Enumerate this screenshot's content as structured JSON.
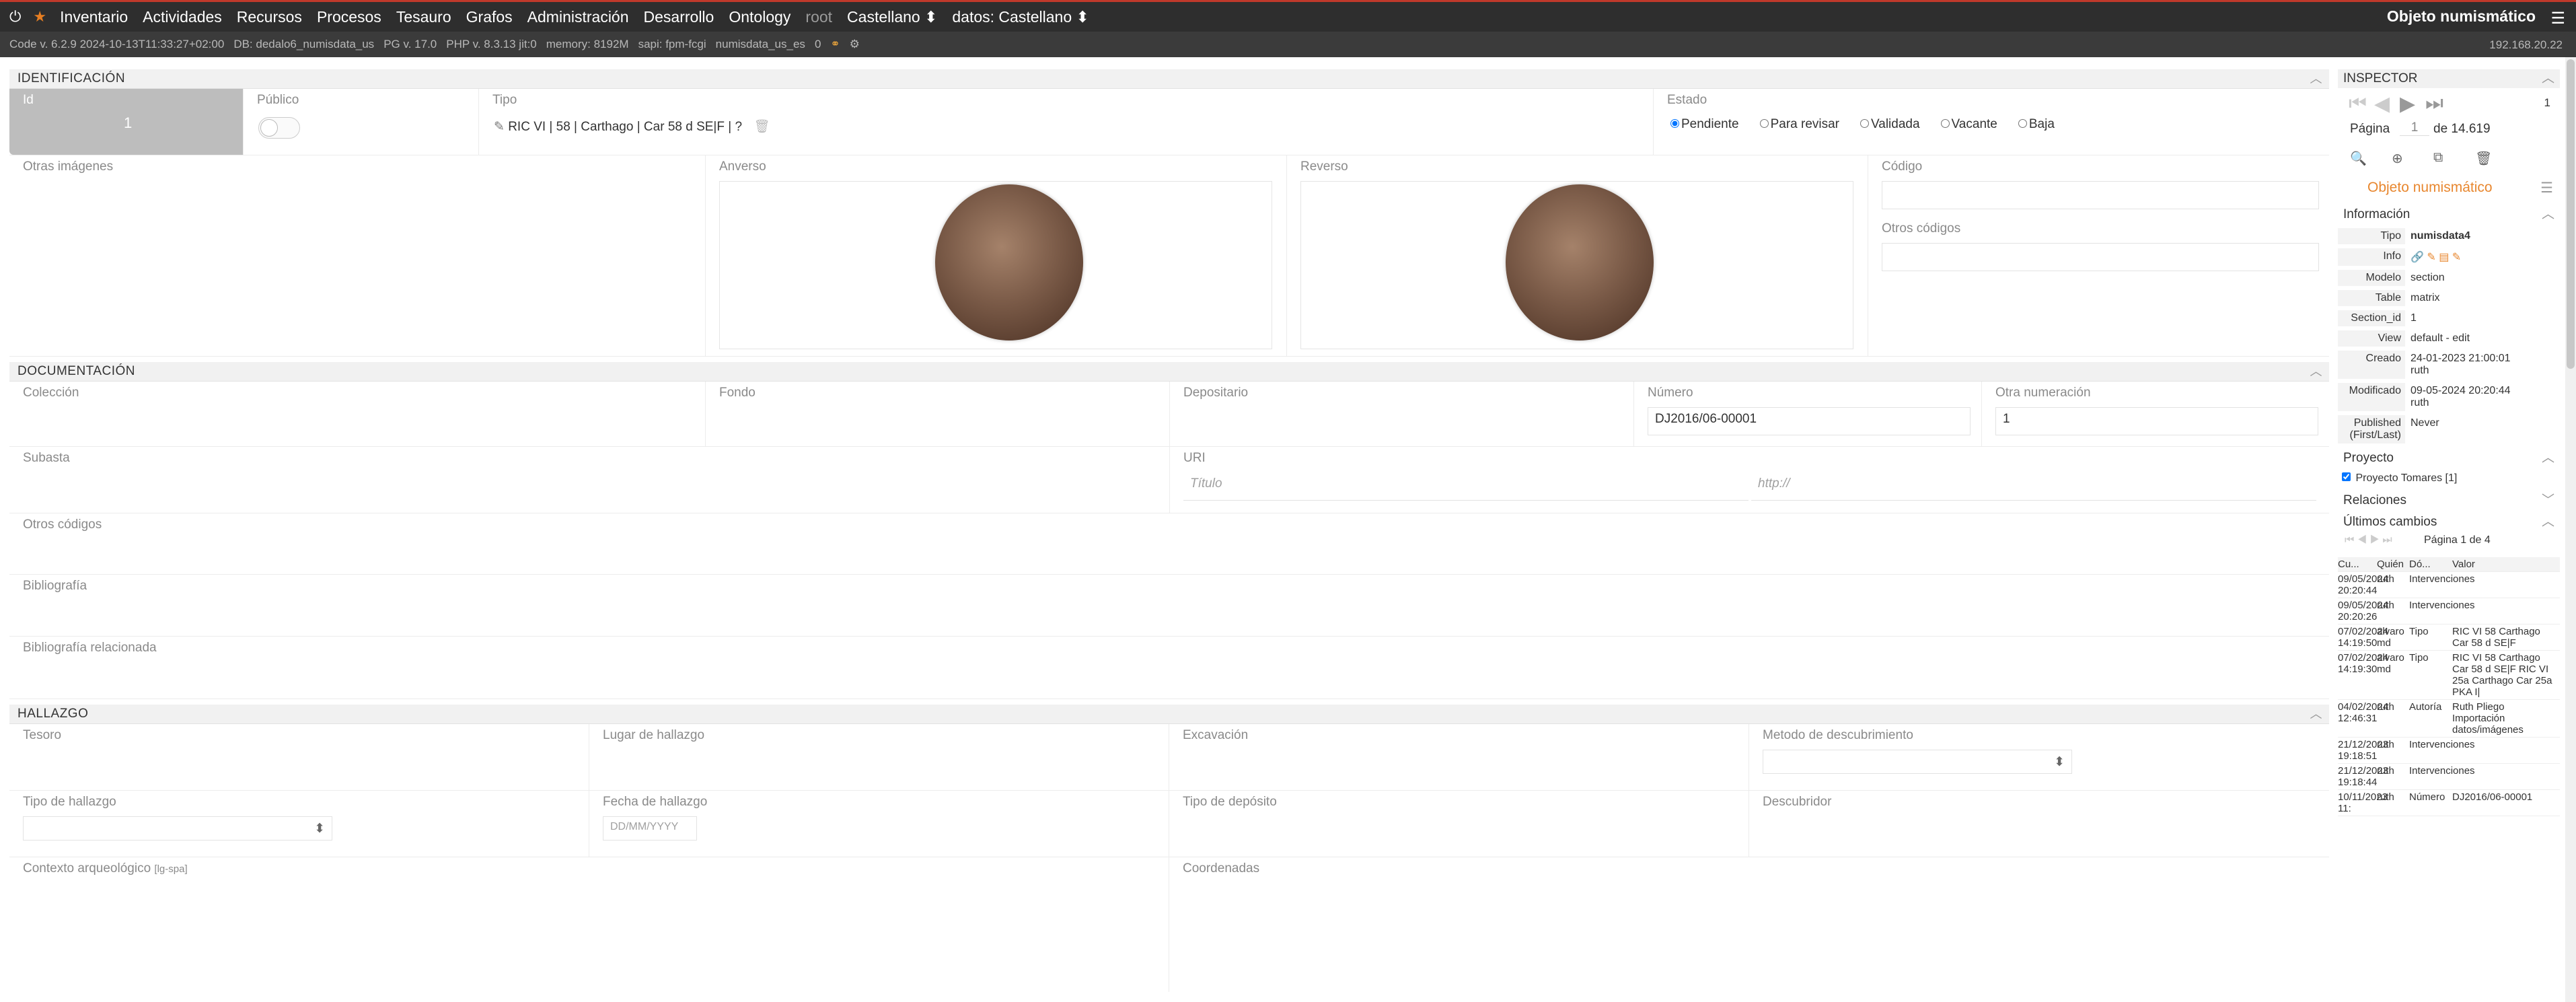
{
  "topnav": {
    "power_icon": "⏻",
    "home_icon": "★",
    "items": [
      "Inventario",
      "Actividades",
      "Recursos",
      "Procesos",
      "Tesauro",
      "Grafos",
      "Administración",
      "Desarrollo"
    ],
    "ontology": "Ontology",
    "user": "root",
    "lang": "Castellano ⬍",
    "data_lang": "datos: Castellano ⬍",
    "section_title": "Objeto numismático",
    "menu_icon": "☰"
  },
  "infobar": {
    "code": "Code v. 6.2.9 2024-10-13T11:33:27+02:00",
    "db": "DB: dedalo6_numisdata_us",
    "pg": "PG v. 17.0",
    "php": "PHP v. 8.3.13 jit:0",
    "memory": "memory: 8192M",
    "sapi": "sapi: fpm-fcgi",
    "entity": "numisdata_us_es",
    "count": "0",
    "ip": "192.168.20.22"
  },
  "identificacion": {
    "title": "IDENTIFICACIÓN",
    "id_label": "Id",
    "id_value": "1",
    "publico_label": "Público",
    "tipo_label": "Tipo",
    "tipo_value": "RIC VI | 58 | Carthago | Car 58 d SE|F | ?",
    "estado_label": "Estado",
    "estado_options": [
      "Pendiente",
      "Para revisar",
      "Validada",
      "Vacante",
      "Baja"
    ],
    "otras_imagenes": "Otras imágenes",
    "anverso": "Anverso",
    "reverso": "Reverso",
    "codigo": "Código",
    "otros_codigos": "Otros códigos"
  },
  "documentacion": {
    "title": "DOCUMENTACIÓN",
    "coleccion": "Colección",
    "fondo": "Fondo",
    "depositario": "Depositario",
    "numero": "Número",
    "numero_value": "DJ2016/06-00001",
    "otra_numeracion": "Otra numeración",
    "otra_numeracion_value": "1",
    "subasta": "Subasta",
    "uri": "URI",
    "uri_title_placeholder": "Título",
    "uri_url_placeholder": "http://",
    "otros_codigos": "Otros códigos",
    "bibliografia": "Bibliografía",
    "bibliografia_rel": "Bibliografía relacionada"
  },
  "hallazgo": {
    "title": "HALLAZGO",
    "tesoro": "Tesoro",
    "lugar": "Lugar de hallazgo",
    "excavacion": "Excavación",
    "metodo": "Metodo de descubrimiento",
    "tipo": "Tipo de hallazgo",
    "fecha": "Fecha de hallazgo",
    "fecha_placeholder": "DD/MM/YYYY",
    "deposito": "Tipo de depósito",
    "descubridor": "Descubridor",
    "contexto": "Contexto arqueológico",
    "contexto_note": "[lg-spa]",
    "coordenadas": "Coordenadas"
  },
  "inspector": {
    "title": "INSPECTOR",
    "nav_count": "1",
    "pagina_label": "Página",
    "pagina_value": "1",
    "pagina_total": "de 14.619",
    "object_title": "Objeto numismático",
    "informacion": "Información",
    "info": [
      {
        "k": "Tipo",
        "v": "numisdata4"
      },
      {
        "k": "Info",
        "v": "🔗 ✎ ▤ ✎"
      },
      {
        "k": "Modelo",
        "v": "section"
      },
      {
        "k": "Table",
        "v": "matrix"
      },
      {
        "k": "Section_id",
        "v": "1"
      },
      {
        "k": "View",
        "v": "default - edit"
      },
      {
        "k": "Creado",
        "v": "24-01-2023 21:00:01 ruth"
      },
      {
        "k": "Modificado",
        "v": "09-05-2024 20:20:44 ruth"
      },
      {
        "k": "Published (First/Last)",
        "v": "Never"
      }
    ],
    "proyecto": "Proyecto",
    "proyecto_item": "Proyecto Tomares [1]",
    "relaciones": "Relaciones",
    "ultimos": "Últimos cambios",
    "pagina_cambios": "Página 1 de 4",
    "changes_header": [
      "Cu...",
      "Quién",
      "Dó...",
      "Valor"
    ],
    "changes": [
      {
        "cu": "09/05/2024 20:20:44",
        "quien": "ruth",
        "do": "Intervenciones",
        "valor": ""
      },
      {
        "cu": "09/05/2024 20:20:26",
        "quien": "ruth",
        "do": "Intervenciones",
        "valor": ""
      },
      {
        "cu": "07/02/2024 14:19:50",
        "quien": "alvaro md",
        "do": "Tipo",
        "valor": "RIC VI 58 Carthago Car 58 d SE|F"
      },
      {
        "cu": "07/02/2024 14:19:30",
        "quien": "alvaro md",
        "do": "Tipo",
        "valor": "RIC VI 58 Carthago Car 58 d SE|F RIC VI 25a Carthago Car 25a PKA I|"
      },
      {
        "cu": "04/02/2024 12:46:31",
        "quien": "ruth",
        "do": "Autoría",
        "valor": "Ruth Pliego Importación datos/imágenes"
      },
      {
        "cu": "21/12/2023 19:18:51",
        "quien": "ruth",
        "do": "Intervenciones",
        "valor": ""
      },
      {
        "cu": "21/12/2023 19:18:44",
        "quien": "ruth",
        "do": "Intervenciones",
        "valor": ""
      },
      {
        "cu": "10/11/2023 11:",
        "quien": "ruth",
        "do": "Número",
        "valor": "DJ2016/06-00001"
      }
    ]
  }
}
